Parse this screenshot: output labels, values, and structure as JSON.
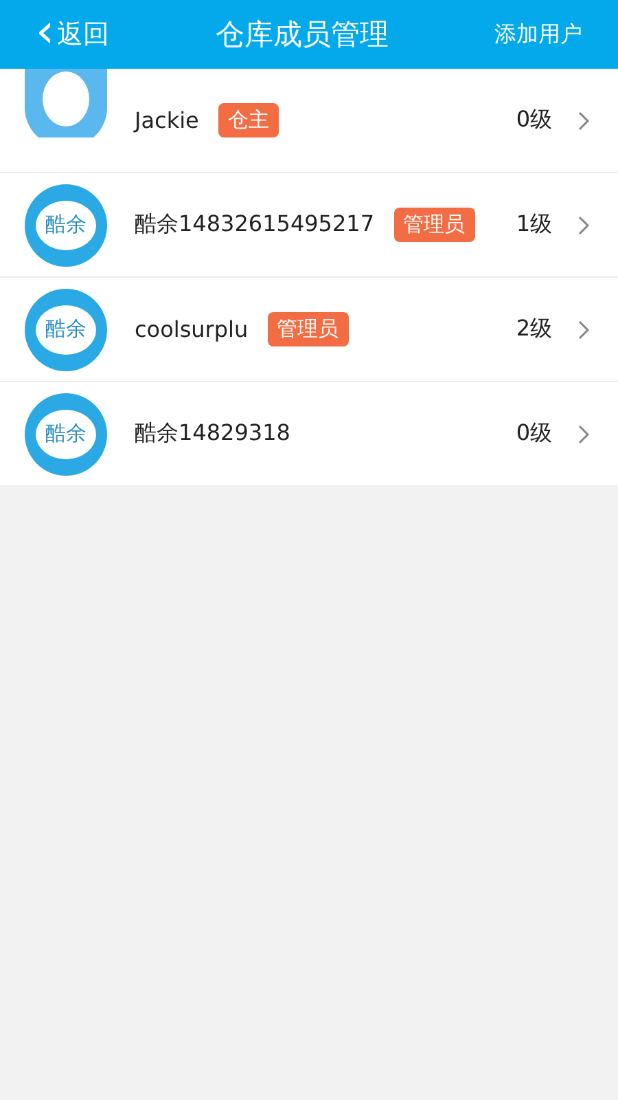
{
  "header": {
    "back_icon": "‹",
    "back_label": "返回",
    "title": "仓库成员管理",
    "action": "添加用户"
  },
  "members": [
    {
      "avatar": {
        "kind": "blank"
      },
      "name": "Jackie",
      "role": "仓主",
      "level": "0级"
    },
    {
      "avatar": {
        "kind": "logo",
        "text": "酷余"
      },
      "name": "酷余14832615495217",
      "role": "管理员",
      "level": "1级"
    },
    {
      "avatar": {
        "kind": "logo",
        "text": "酷余"
      },
      "name": "coolsurplu",
      "role": "管理员",
      "level": "2级"
    },
    {
      "avatar": {
        "kind": "logo",
        "text": "酷余"
      },
      "name": "酷余14829318",
      "level": "0级"
    }
  ]
}
